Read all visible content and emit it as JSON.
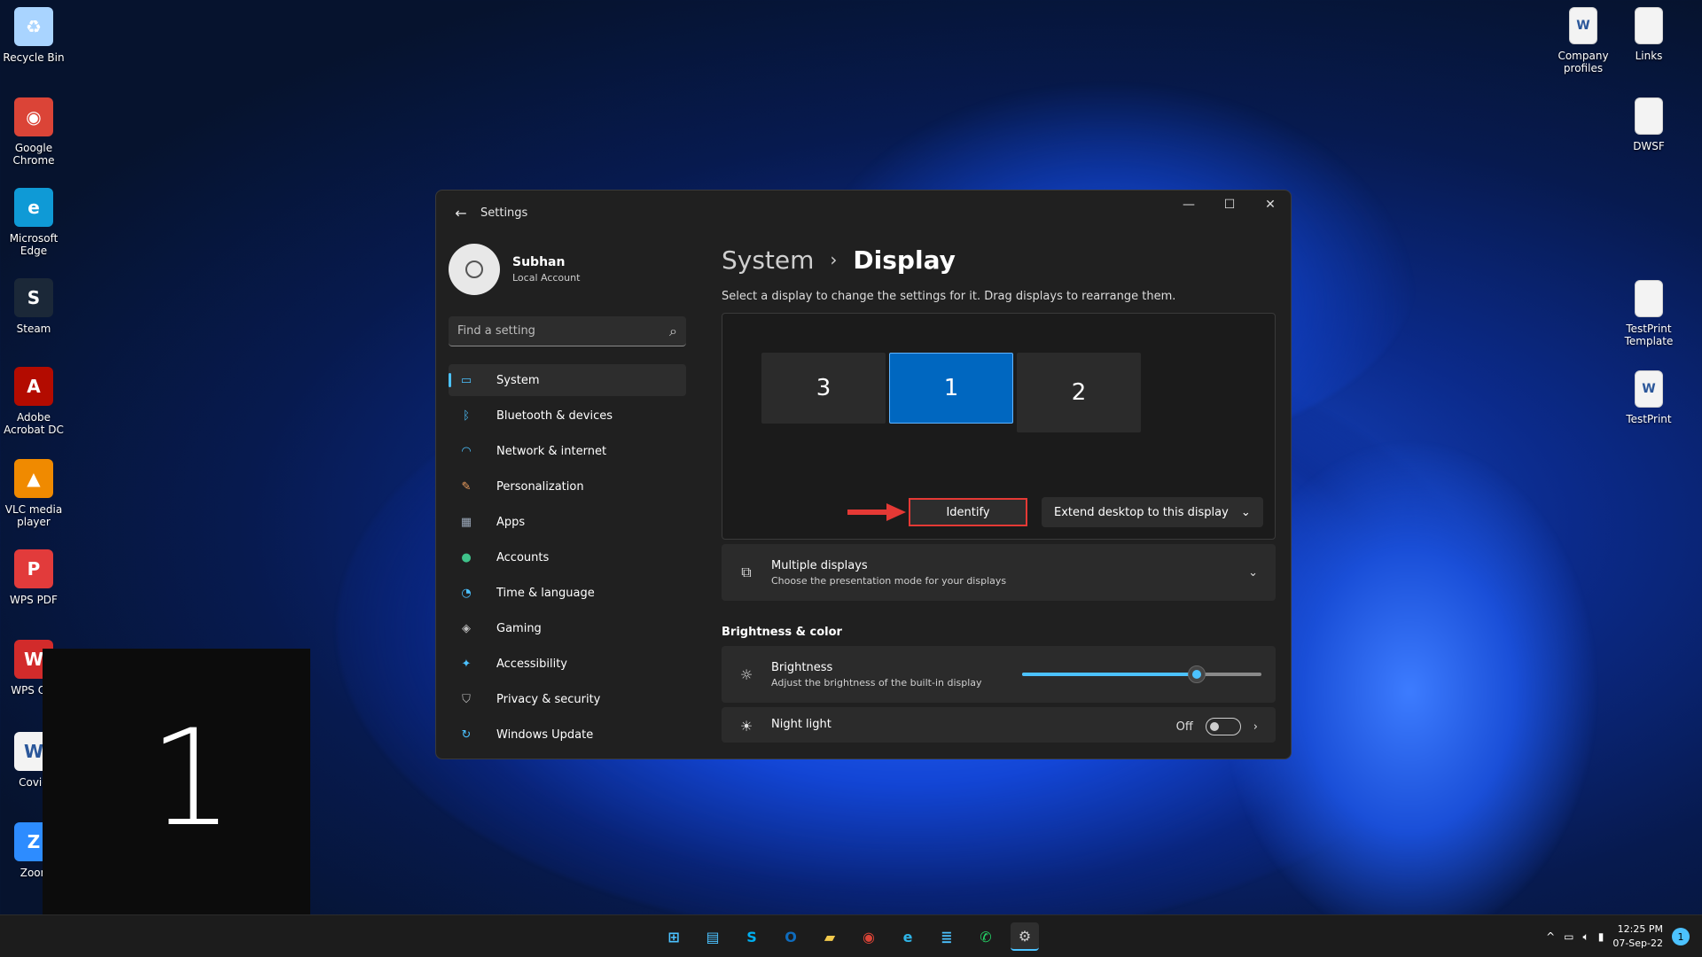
{
  "desktop": {
    "left_icons": [
      {
        "label": "Recycle Bin",
        "glyph": "♻",
        "icon": "recycle-bin-icon",
        "color": "#a9d4ff"
      },
      {
        "label": "Google Chrome",
        "glyph": "◉",
        "icon": "chrome-icon",
        "color": "#db4437"
      },
      {
        "label": "Microsoft Edge",
        "glyph": "e",
        "icon": "edge-icon",
        "color": "#0f9ad6"
      },
      {
        "label": "Steam",
        "glyph": "S",
        "icon": "steam-icon",
        "color": "#1b2838"
      },
      {
        "label": "Adobe Acrobat DC",
        "glyph": "A",
        "icon": "acrobat-icon",
        "color": "#b30b00"
      },
      {
        "label": "VLC media player",
        "glyph": "▲",
        "icon": "vlc-icon",
        "color": "#f08a00"
      },
      {
        "label": "WPS PDF",
        "glyph": "P",
        "icon": "wps-pdf-icon",
        "color": "#e23b3b"
      },
      {
        "label": "WPS Offi",
        "glyph": "W",
        "icon": "wps-office-icon",
        "color": "#d22b2b"
      },
      {
        "label": "Covid",
        "glyph": "W",
        "icon": "word-doc-icon",
        "color": "#f3f3f3"
      },
      {
        "label": "Zoon",
        "glyph": "Z",
        "icon": "zoom-icon",
        "color": "#2d8cff"
      }
    ],
    "right_icons": [
      {
        "label": "Company profiles",
        "icon": "word-doc-icon",
        "glyph": "W"
      },
      {
        "label": "Links",
        "icon": "text-file-icon",
        "glyph": ""
      },
      {
        "label": "DWSF",
        "icon": "text-file-icon",
        "glyph": ""
      },
      {
        "label": "TestPrint Template",
        "icon": "text-file-icon",
        "glyph": ""
      },
      {
        "label": "TestPrint",
        "icon": "word-doc-icon",
        "glyph": "W"
      }
    ]
  },
  "identify_overlay": {
    "number": "1"
  },
  "window": {
    "title": "Settings",
    "back_glyph": "←",
    "controls": {
      "minimize": "—",
      "maximize": "☐",
      "close": "✕"
    }
  },
  "profile": {
    "name": "Subhan",
    "account": "Local Account"
  },
  "search": {
    "placeholder": "Find a setting",
    "glyph": "⌕"
  },
  "nav": [
    {
      "label": "System",
      "icon": "system-icon",
      "glyph": "▭",
      "color": "#4cc2ff",
      "active": true
    },
    {
      "label": "Bluetooth & devices",
      "icon": "bluetooth-icon",
      "glyph": "ᛒ",
      "color": "#4cc2ff",
      "active": false
    },
    {
      "label": "Network & internet",
      "icon": "wifi-icon",
      "glyph": "◠",
      "color": "#4cc2ff",
      "active": false
    },
    {
      "label": "Personalization",
      "icon": "brush-icon",
      "glyph": "✎",
      "color": "#f0a060",
      "active": false
    },
    {
      "label": "Apps",
      "icon": "apps-icon",
      "glyph": "▦",
      "color": "#9aa7b8",
      "active": false
    },
    {
      "label": "Accounts",
      "icon": "accounts-icon",
      "glyph": "●",
      "color": "#3fc28a",
      "active": false
    },
    {
      "label": "Time & language",
      "icon": "clock-globe-icon",
      "glyph": "◔",
      "color": "#4cc2ff",
      "active": false
    },
    {
      "label": "Gaming",
      "icon": "gamepad-icon",
      "glyph": "◈",
      "color": "#bfbfbf",
      "active": false
    },
    {
      "label": "Accessibility",
      "icon": "accessibility-icon",
      "glyph": "✦",
      "color": "#4cc2ff",
      "active": false
    },
    {
      "label": "Privacy & security",
      "icon": "shield-icon",
      "glyph": "⛉",
      "color": "#bfbfbf",
      "active": false
    },
    {
      "label": "Windows Update",
      "icon": "update-icon",
      "glyph": "↻",
      "color": "#4cc2ff",
      "active": false
    }
  ],
  "page": {
    "breadcrumb_parent": "System",
    "breadcrumb_sep": "›",
    "breadcrumb_current": "Display",
    "hint": "Select a display to change the settings for it. Drag displays to rearrange them."
  },
  "displays": [
    {
      "number": "3",
      "selected": false
    },
    {
      "number": "1",
      "selected": true
    },
    {
      "number": "2",
      "selected": false
    }
  ],
  "identify_label": "Identify",
  "extend": {
    "label": "Extend desktop to this display",
    "chevron": "⌄"
  },
  "multiple_displays": {
    "title": "Multiple displays",
    "subtitle": "Choose the presentation mode for your displays",
    "chevron": "⌄"
  },
  "section_brightness": "Brightness & color",
  "brightness": {
    "title": "Brightness",
    "subtitle": "Adjust the brightness of the built-in display",
    "level": 0.73
  },
  "night_light": {
    "title": "Night light",
    "state": "Off",
    "chevron": "›"
  },
  "taskbar": {
    "icons": [
      {
        "icon": "start-icon",
        "glyph": "⊞",
        "color": "#4cc2ff",
        "active": false
      },
      {
        "icon": "store-icon",
        "glyph": "▤",
        "color": "#4cc2ff",
        "active": false
      },
      {
        "icon": "skype-icon",
        "glyph": "S",
        "color": "#00aff0",
        "active": false
      },
      {
        "icon": "outlook-icon",
        "glyph": "O",
        "color": "#0f6cbd",
        "active": false
      },
      {
        "icon": "file-explorer-icon",
        "glyph": "▰",
        "color": "#f2c94c",
        "active": false
      },
      {
        "icon": "chrome-icon",
        "glyph": "◉",
        "color": "#db4437",
        "active": false
      },
      {
        "icon": "edge-icon",
        "glyph": "e",
        "color": "#2fb5e8",
        "active": false
      },
      {
        "icon": "notepad-icon",
        "glyph": "≣",
        "color": "#4cc2ff",
        "active": false
      },
      {
        "icon": "whatsapp-icon",
        "glyph": "✆",
        "color": "#25d366",
        "active": false
      },
      {
        "icon": "settings-icon",
        "glyph": "⚙",
        "color": "#cfcfcf",
        "active": true
      }
    ],
    "tray": {
      "chevron": "^",
      "time": "12:25 PM",
      "date": "07-Sep-22",
      "notifications": "1"
    }
  }
}
